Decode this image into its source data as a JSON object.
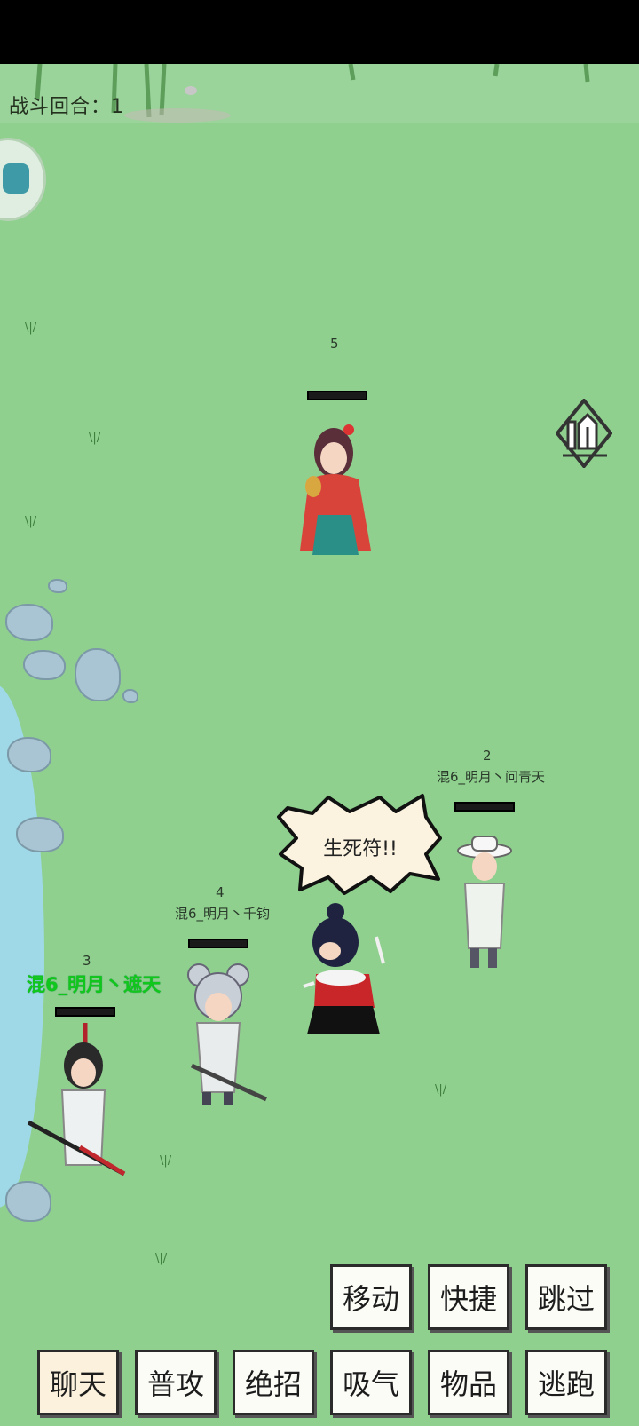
{
  "battle": {
    "round_label": "战斗回合：1"
  },
  "units": [
    {
      "number": "5",
      "name": ""
    },
    {
      "number": "2",
      "name": "混6_明月丶问青天"
    },
    {
      "number": "4",
      "name": "混6_明月丶千钧"
    },
    {
      "number": "3",
      "name": "混6_明月丶遮天"
    }
  ],
  "speech": {
    "text": "生死符!!"
  },
  "actions": {
    "move": "移动",
    "quick": "快捷",
    "skip": "跳过",
    "chat": "聊天",
    "attack": "普攻",
    "ultimate": "绝招",
    "breathe": "吸气",
    "items": "物品",
    "escape": "逃跑"
  },
  "colors": {
    "field": "#8fd08f",
    "self_name": "#10c81c"
  },
  "icons": {
    "map": "map-icon",
    "portal": "portal-icon"
  }
}
